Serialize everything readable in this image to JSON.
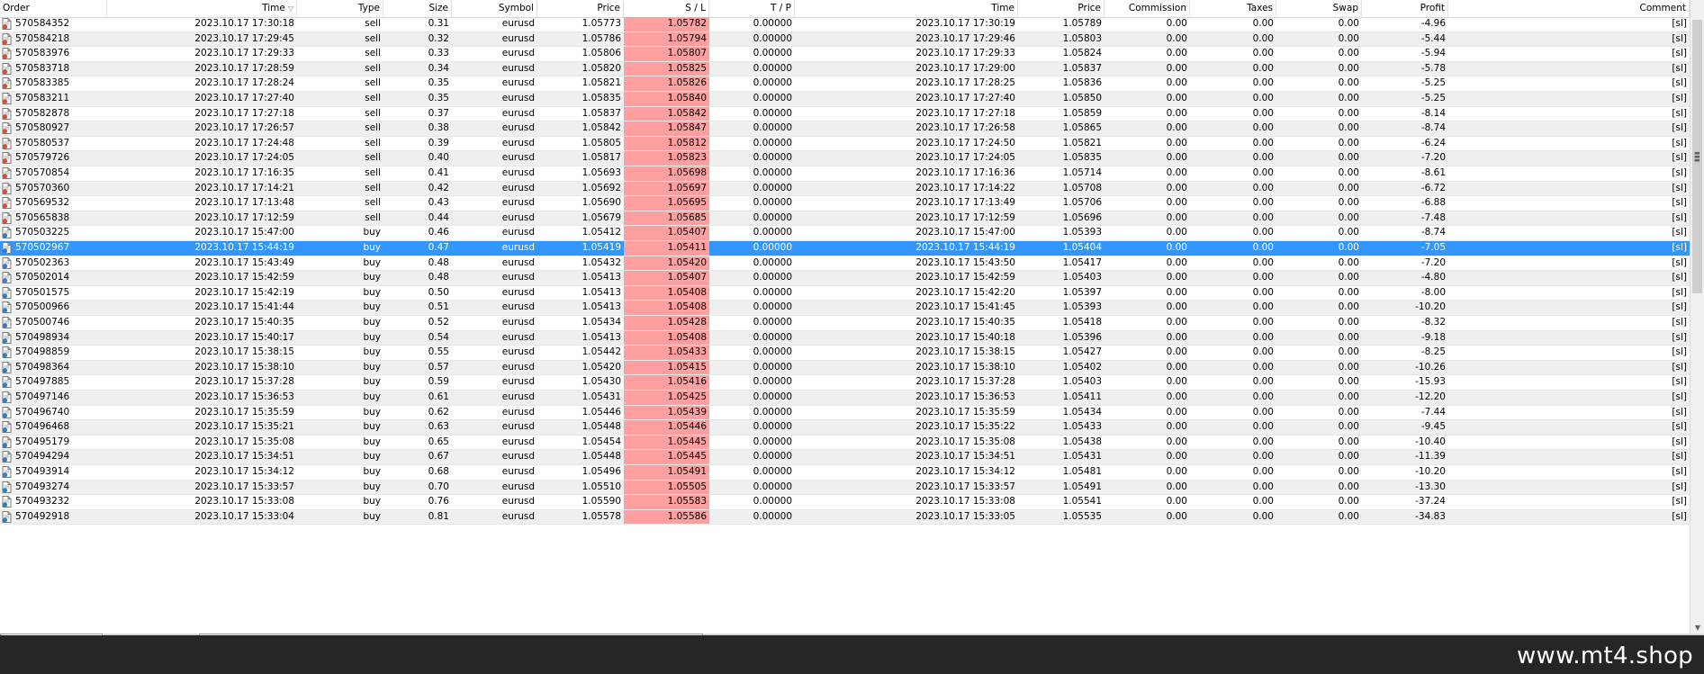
{
  "columns": {
    "order": "Order",
    "time_open": "Time",
    "type": "Type",
    "size": "Size",
    "symbol": "Symbol",
    "price_open": "Price",
    "sl": "S / L",
    "tp": "T / P",
    "time_close": "Time",
    "price_close": "Price",
    "commission": "Commission",
    "taxes": "Taxes",
    "swap": "Swap",
    "profit": "Profit",
    "comment": "Comment"
  },
  "colors": {
    "sl_highlight": "#ff9f9f",
    "selected_row": "#3396ff",
    "alt_row": "#efefef",
    "sell_icon_accent": "#e24a2b",
    "buy_icon_accent": "#2a7fd4"
  },
  "icons": {
    "sort": "sort-descending-icon",
    "sell_order": "sell-order-icon",
    "buy_order": "buy-order-icon"
  },
  "selected_order": "570502967",
  "rows": [
    {
      "order": "570584352",
      "time_open": "2023.10.17 17:30:18",
      "type": "sell",
      "size": "0.31",
      "symbol": "eurusd",
      "price_open": "1.05773",
      "sl": "1.05782",
      "tp": "0.00000",
      "time_close": "2023.10.17 17:30:19",
      "price_close": "1.05789",
      "commission": "0.00",
      "taxes": "0.00",
      "swap": "0.00",
      "profit": "-4.96",
      "comment": "[sl]"
    },
    {
      "order": "570584218",
      "time_open": "2023.10.17 17:29:45",
      "type": "sell",
      "size": "0.32",
      "symbol": "eurusd",
      "price_open": "1.05786",
      "sl": "1.05794",
      "tp": "0.00000",
      "time_close": "2023.10.17 17:29:46",
      "price_close": "1.05803",
      "commission": "0.00",
      "taxes": "0.00",
      "swap": "0.00",
      "profit": "-5.44",
      "comment": "[sl]"
    },
    {
      "order": "570583976",
      "time_open": "2023.10.17 17:29:33",
      "type": "sell",
      "size": "0.33",
      "symbol": "eurusd",
      "price_open": "1.05806",
      "sl": "1.05807",
      "tp": "0.00000",
      "time_close": "2023.10.17 17:29:33",
      "price_close": "1.05824",
      "commission": "0.00",
      "taxes": "0.00",
      "swap": "0.00",
      "profit": "-5.94",
      "comment": "[sl]"
    },
    {
      "order": "570583718",
      "time_open": "2023.10.17 17:28:59",
      "type": "sell",
      "size": "0.34",
      "symbol": "eurusd",
      "price_open": "1.05820",
      "sl": "1.05825",
      "tp": "0.00000",
      "time_close": "2023.10.17 17:29:00",
      "price_close": "1.05837",
      "commission": "0.00",
      "taxes": "0.00",
      "swap": "0.00",
      "profit": "-5.78",
      "comment": "[sl]"
    },
    {
      "order": "570583385",
      "time_open": "2023.10.17 17:28:24",
      "type": "sell",
      "size": "0.35",
      "symbol": "eurusd",
      "price_open": "1.05821",
      "sl": "1.05826",
      "tp": "0.00000",
      "time_close": "2023.10.17 17:28:25",
      "price_close": "1.05836",
      "commission": "0.00",
      "taxes": "0.00",
      "swap": "0.00",
      "profit": "-5.25",
      "comment": "[sl]"
    },
    {
      "order": "570583211",
      "time_open": "2023.10.17 17:27:40",
      "type": "sell",
      "size": "0.35",
      "symbol": "eurusd",
      "price_open": "1.05835",
      "sl": "1.05840",
      "tp": "0.00000",
      "time_close": "2023.10.17 17:27:40",
      "price_close": "1.05850",
      "commission": "0.00",
      "taxes": "0.00",
      "swap": "0.00",
      "profit": "-5.25",
      "comment": "[sl]"
    },
    {
      "order": "570582878",
      "time_open": "2023.10.17 17:27:18",
      "type": "sell",
      "size": "0.37",
      "symbol": "eurusd",
      "price_open": "1.05837",
      "sl": "1.05842",
      "tp": "0.00000",
      "time_close": "2023.10.17 17:27:18",
      "price_close": "1.05859",
      "commission": "0.00",
      "taxes": "0.00",
      "swap": "0.00",
      "profit": "-8.14",
      "comment": "[sl]"
    },
    {
      "order": "570580927",
      "time_open": "2023.10.17 17:26:57",
      "type": "sell",
      "size": "0.38",
      "symbol": "eurusd",
      "price_open": "1.05842",
      "sl": "1.05847",
      "tp": "0.00000",
      "time_close": "2023.10.17 17:26:58",
      "price_close": "1.05865",
      "commission": "0.00",
      "taxes": "0.00",
      "swap": "0.00",
      "profit": "-8.74",
      "comment": "[sl]"
    },
    {
      "order": "570580537",
      "time_open": "2023.10.17 17:24:48",
      "type": "sell",
      "size": "0.39",
      "symbol": "eurusd",
      "price_open": "1.05805",
      "sl": "1.05812",
      "tp": "0.00000",
      "time_close": "2023.10.17 17:24:50",
      "price_close": "1.05821",
      "commission": "0.00",
      "taxes": "0.00",
      "swap": "0.00",
      "profit": "-6.24",
      "comment": "[sl]"
    },
    {
      "order": "570579726",
      "time_open": "2023.10.17 17:24:05",
      "type": "sell",
      "size": "0.40",
      "symbol": "eurusd",
      "price_open": "1.05817",
      "sl": "1.05823",
      "tp": "0.00000",
      "time_close": "2023.10.17 17:24:05",
      "price_close": "1.05835",
      "commission": "0.00",
      "taxes": "0.00",
      "swap": "0.00",
      "profit": "-7.20",
      "comment": "[sl]"
    },
    {
      "order": "570570854",
      "time_open": "2023.10.17 17:16:35",
      "type": "sell",
      "size": "0.41",
      "symbol": "eurusd",
      "price_open": "1.05693",
      "sl": "1.05698",
      "tp": "0.00000",
      "time_close": "2023.10.17 17:16:36",
      "price_close": "1.05714",
      "commission": "0.00",
      "taxes": "0.00",
      "swap": "0.00",
      "profit": "-8.61",
      "comment": "[sl]"
    },
    {
      "order": "570570360",
      "time_open": "2023.10.17 17:14:21",
      "type": "sell",
      "size": "0.42",
      "symbol": "eurusd",
      "price_open": "1.05692",
      "sl": "1.05697",
      "tp": "0.00000",
      "time_close": "2023.10.17 17:14:22",
      "price_close": "1.05708",
      "commission": "0.00",
      "taxes": "0.00",
      "swap": "0.00",
      "profit": "-6.72",
      "comment": "[sl]"
    },
    {
      "order": "570569532",
      "time_open": "2023.10.17 17:13:48",
      "type": "sell",
      "size": "0.43",
      "symbol": "eurusd",
      "price_open": "1.05690",
      "sl": "1.05695",
      "tp": "0.00000",
      "time_close": "2023.10.17 17:13:49",
      "price_close": "1.05706",
      "commission": "0.00",
      "taxes": "0.00",
      "swap": "0.00",
      "profit": "-6.88",
      "comment": "[sl]"
    },
    {
      "order": "570565838",
      "time_open": "2023.10.17 17:12:59",
      "type": "sell",
      "size": "0.44",
      "symbol": "eurusd",
      "price_open": "1.05679",
      "sl": "1.05685",
      "tp": "0.00000",
      "time_close": "2023.10.17 17:12:59",
      "price_close": "1.05696",
      "commission": "0.00",
      "taxes": "0.00",
      "swap": "0.00",
      "profit": "-7.48",
      "comment": "[sl]"
    },
    {
      "order": "570503225",
      "time_open": "2023.10.17 15:47:00",
      "type": "buy",
      "size": "0.46",
      "symbol": "eurusd",
      "price_open": "1.05412",
      "sl": "1.05407",
      "tp": "0.00000",
      "time_close": "2023.10.17 15:47:00",
      "price_close": "1.05393",
      "commission": "0.00",
      "taxes": "0.00",
      "swap": "0.00",
      "profit": "-8.74",
      "comment": "[sl]"
    },
    {
      "order": "570502967",
      "time_open": "2023.10.17 15:44:19",
      "type": "buy",
      "size": "0.47",
      "symbol": "eurusd",
      "price_open": "1.05419",
      "sl": "1.05411",
      "tp": "0.00000",
      "time_close": "2023.10.17 15:44:19",
      "price_close": "1.05404",
      "commission": "0.00",
      "taxes": "0.00",
      "swap": "0.00",
      "profit": "-7.05",
      "comment": "[sl]"
    },
    {
      "order": "570502363",
      "time_open": "2023.10.17 15:43:49",
      "type": "buy",
      "size": "0.48",
      "symbol": "eurusd",
      "price_open": "1.05432",
      "sl": "1.05420",
      "tp": "0.00000",
      "time_close": "2023.10.17 15:43:50",
      "price_close": "1.05417",
      "commission": "0.00",
      "taxes": "0.00",
      "swap": "0.00",
      "profit": "-7.20",
      "comment": "[sl]"
    },
    {
      "order": "570502014",
      "time_open": "2023.10.17 15:42:59",
      "type": "buy",
      "size": "0.48",
      "symbol": "eurusd",
      "price_open": "1.05413",
      "sl": "1.05407",
      "tp": "0.00000",
      "time_close": "2023.10.17 15:42:59",
      "price_close": "1.05403",
      "commission": "0.00",
      "taxes": "0.00",
      "swap": "0.00",
      "profit": "-4.80",
      "comment": "[sl]"
    },
    {
      "order": "570501575",
      "time_open": "2023.10.17 15:42:19",
      "type": "buy",
      "size": "0.50",
      "symbol": "eurusd",
      "price_open": "1.05413",
      "sl": "1.05408",
      "tp": "0.00000",
      "time_close": "2023.10.17 15:42:20",
      "price_close": "1.05397",
      "commission": "0.00",
      "taxes": "0.00",
      "swap": "0.00",
      "profit": "-8.00",
      "comment": "[sl]"
    },
    {
      "order": "570500966",
      "time_open": "2023.10.17 15:41:44",
      "type": "buy",
      "size": "0.51",
      "symbol": "eurusd",
      "price_open": "1.05413",
      "sl": "1.05408",
      "tp": "0.00000",
      "time_close": "2023.10.17 15:41:45",
      "price_close": "1.05393",
      "commission": "0.00",
      "taxes": "0.00",
      "swap": "0.00",
      "profit": "-10.20",
      "comment": "[sl]"
    },
    {
      "order": "570500746",
      "time_open": "2023.10.17 15:40:35",
      "type": "buy",
      "size": "0.52",
      "symbol": "eurusd",
      "price_open": "1.05434",
      "sl": "1.05428",
      "tp": "0.00000",
      "time_close": "2023.10.17 15:40:35",
      "price_close": "1.05418",
      "commission": "0.00",
      "taxes": "0.00",
      "swap": "0.00",
      "profit": "-8.32",
      "comment": "[sl]"
    },
    {
      "order": "570498934",
      "time_open": "2023.10.17 15:40:17",
      "type": "buy",
      "size": "0.54",
      "symbol": "eurusd",
      "price_open": "1.05413",
      "sl": "1.05408",
      "tp": "0.00000",
      "time_close": "2023.10.17 15:40:18",
      "price_close": "1.05396",
      "commission": "0.00",
      "taxes": "0.00",
      "swap": "0.00",
      "profit": "-9.18",
      "comment": "[sl]"
    },
    {
      "order": "570498859",
      "time_open": "2023.10.17 15:38:15",
      "type": "buy",
      "size": "0.55",
      "symbol": "eurusd",
      "price_open": "1.05442",
      "sl": "1.05433",
      "tp": "0.00000",
      "time_close": "2023.10.17 15:38:15",
      "price_close": "1.05427",
      "commission": "0.00",
      "taxes": "0.00",
      "swap": "0.00",
      "profit": "-8.25",
      "comment": "[sl]"
    },
    {
      "order": "570498364",
      "time_open": "2023.10.17 15:38:10",
      "type": "buy",
      "size": "0.57",
      "symbol": "eurusd",
      "price_open": "1.05420",
      "sl": "1.05415",
      "tp": "0.00000",
      "time_close": "2023.10.17 15:38:10",
      "price_close": "1.05402",
      "commission": "0.00",
      "taxes": "0.00",
      "swap": "0.00",
      "profit": "-10.26",
      "comment": "[sl]"
    },
    {
      "order": "570497885",
      "time_open": "2023.10.17 15:37:28",
      "type": "buy",
      "size": "0.59",
      "symbol": "eurusd",
      "price_open": "1.05430",
      "sl": "1.05416",
      "tp": "0.00000",
      "time_close": "2023.10.17 15:37:28",
      "price_close": "1.05403",
      "commission": "0.00",
      "taxes": "0.00",
      "swap": "0.00",
      "profit": "-15.93",
      "comment": "[sl]"
    },
    {
      "order": "570497146",
      "time_open": "2023.10.17 15:36:53",
      "type": "buy",
      "size": "0.61",
      "symbol": "eurusd",
      "price_open": "1.05431",
      "sl": "1.05425",
      "tp": "0.00000",
      "time_close": "2023.10.17 15:36:53",
      "price_close": "1.05411",
      "commission": "0.00",
      "taxes": "0.00",
      "swap": "0.00",
      "profit": "-12.20",
      "comment": "[sl]"
    },
    {
      "order": "570496740",
      "time_open": "2023.10.17 15:35:59",
      "type": "buy",
      "size": "0.62",
      "symbol": "eurusd",
      "price_open": "1.05446",
      "sl": "1.05439",
      "tp": "0.00000",
      "time_close": "2023.10.17 15:35:59",
      "price_close": "1.05434",
      "commission": "0.00",
      "taxes": "0.00",
      "swap": "0.00",
      "profit": "-7.44",
      "comment": "[sl]"
    },
    {
      "order": "570496468",
      "time_open": "2023.10.17 15:35:21",
      "type": "buy",
      "size": "0.63",
      "symbol": "eurusd",
      "price_open": "1.05448",
      "sl": "1.05446",
      "tp": "0.00000",
      "time_close": "2023.10.17 15:35:22",
      "price_close": "1.05433",
      "commission": "0.00",
      "taxes": "0.00",
      "swap": "0.00",
      "profit": "-9.45",
      "comment": "[sl]"
    },
    {
      "order": "570495179",
      "time_open": "2023.10.17 15:35:08",
      "type": "buy",
      "size": "0.65",
      "symbol": "eurusd",
      "price_open": "1.05454",
      "sl": "1.05445",
      "tp": "0.00000",
      "time_close": "2023.10.17 15:35:08",
      "price_close": "1.05438",
      "commission": "0.00",
      "taxes": "0.00",
      "swap": "0.00",
      "profit": "-10.40",
      "comment": "[sl]"
    },
    {
      "order": "570494294",
      "time_open": "2023.10.17 15:34:51",
      "type": "buy",
      "size": "0.67",
      "symbol": "eurusd",
      "price_open": "1.05448",
      "sl": "1.05445",
      "tp": "0.00000",
      "time_close": "2023.10.17 15:34:51",
      "price_close": "1.05431",
      "commission": "0.00",
      "taxes": "0.00",
      "swap": "0.00",
      "profit": "-11.39",
      "comment": "[sl]"
    },
    {
      "order": "570493914",
      "time_open": "2023.10.17 15:34:12",
      "type": "buy",
      "size": "0.68",
      "symbol": "eurusd",
      "price_open": "1.05496",
      "sl": "1.05491",
      "tp": "0.00000",
      "time_close": "2023.10.17 15:34:12",
      "price_close": "1.05481",
      "commission": "0.00",
      "taxes": "0.00",
      "swap": "0.00",
      "profit": "-10.20",
      "comment": "[sl]"
    },
    {
      "order": "570493274",
      "time_open": "2023.10.17 15:33:57",
      "type": "buy",
      "size": "0.70",
      "symbol": "eurusd",
      "price_open": "1.05510",
      "sl": "1.05505",
      "tp": "0.00000",
      "time_close": "2023.10.17 15:33:57",
      "price_close": "1.05491",
      "commission": "0.00",
      "taxes": "0.00",
      "swap": "0.00",
      "profit": "-13.30",
      "comment": "[sl]"
    },
    {
      "order": "570493232",
      "time_open": "2023.10.17 15:33:08",
      "type": "buy",
      "size": "0.76",
      "symbol": "eurusd",
      "price_open": "1.05590",
      "sl": "1.05583",
      "tp": "0.00000",
      "time_close": "2023.10.17 15:33:08",
      "price_close": "1.05541",
      "commission": "0.00",
      "taxes": "0.00",
      "swap": "0.00",
      "profit": "-37.24",
      "comment": "[sl]"
    },
    {
      "order": "570492918",
      "time_open": "2023.10.17 15:33:04",
      "type": "buy",
      "size": "0.81",
      "symbol": "eurusd",
      "price_open": "1.05578",
      "sl": "1.05586",
      "tp": "0.00000",
      "time_close": "2023.10.17 15:33:05",
      "price_close": "1.05535",
      "commission": "0.00",
      "taxes": "0.00",
      "swap": "0.00",
      "profit": "-34.83",
      "comment": "[sl]"
    }
  ],
  "footer": {
    "watermark": "www.mt4.shop"
  }
}
